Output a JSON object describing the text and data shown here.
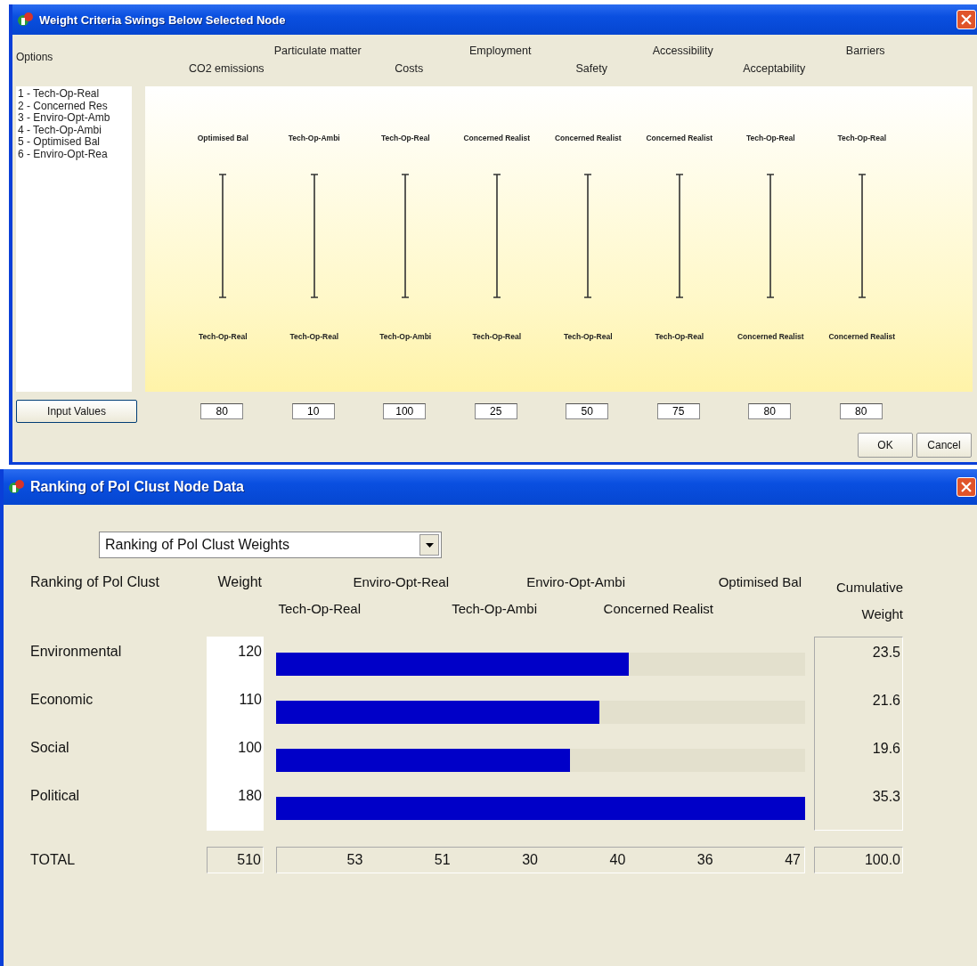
{
  "swing_window": {
    "title": "Weight Criteria Swings Below Selected Node",
    "options_label": "Options",
    "options": [
      "1 - Tech-Op-Real",
      "2 - Concerned Res",
      "3 - Enviro-Opt-Amb",
      "4 - Tech-Op-Ambi",
      "5 - Optimised Bal",
      "6 - Enviro-Opt-Rea"
    ],
    "criteria": [
      {
        "name": "CO2 emissions",
        "top": "Optimised Bal",
        "bottom": "Tech-Op-Real",
        "value": "80"
      },
      {
        "name": "Particulate matter",
        "top": "Tech-Op-Ambi",
        "bottom": "Tech-Op-Real",
        "value": "10"
      },
      {
        "name": "Costs",
        "top": "Tech-Op-Real",
        "bottom": "Tech-Op-Ambi",
        "value": "100"
      },
      {
        "name": "Employment",
        "top": "Concerned Realist",
        "bottom": "Tech-Op-Real",
        "value": "25"
      },
      {
        "name": "Safety",
        "top": "Concerned Realist",
        "bottom": "Tech-Op-Real",
        "value": "50"
      },
      {
        "name": "Accessibility",
        "top": "Concerned Realist",
        "bottom": "Tech-Op-Real",
        "value": "75"
      },
      {
        "name": "Acceptability",
        "top": "Tech-Op-Real",
        "bottom": "Concerned Realist",
        "value": "80"
      },
      {
        "name": "Barriers",
        "top": "Tech-Op-Real",
        "bottom": "Concerned Realist",
        "value": "80"
      }
    ],
    "input_button": "Input Values",
    "buttons": [
      "OK",
      "Cancel"
    ]
  },
  "ranking_window": {
    "title": "Ranking of Pol Clust Node Data",
    "dropdown": {
      "value": "Ranking of Pol Clust Weights"
    },
    "headers": {
      "label": "Ranking of Pol Clust",
      "weight": "Weight",
      "options": [
        "Tech-Op-Real",
        "Enviro-Opt-Real",
        "Tech-Op-Ambi",
        "Enviro-Opt-Ambi",
        "Concerned Realist",
        "Optimised Bal"
      ],
      "cumulative": "Cumulative Weight"
    },
    "rows": [
      {
        "label": "Environmental",
        "weight": "120",
        "level": 0.667,
        "cumulative": "23.5"
      },
      {
        "label": "Economic",
        "weight": "110",
        "level": 0.611,
        "cumulative": "21.6"
      },
      {
        "label": "Social",
        "weight": "100",
        "level": 0.556,
        "cumulative": "19.6"
      },
      {
        "label": "Political",
        "weight": "180",
        "level": 1.0,
        "cumulative": "35.3"
      }
    ],
    "total": {
      "label": "TOTAL",
      "weight": "510",
      "options": [
        "53",
        "51",
        "30",
        "40",
        "36",
        "47"
      ],
      "cumulative": "100.0"
    }
  }
}
